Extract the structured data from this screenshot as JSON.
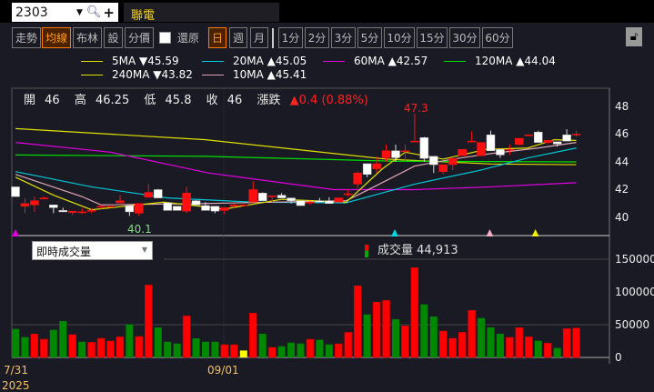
{
  "header": {
    "symbol": "2303",
    "stock_name": "聯電"
  },
  "toolbar": {
    "buttons": [
      {
        "label": "走勢",
        "active": false
      },
      {
        "label": "均線",
        "active": true
      },
      {
        "label": "布林",
        "active": false
      },
      {
        "label": "設",
        "active": false
      },
      {
        "label": "分價",
        "active": false
      }
    ],
    "restore_label": "還原",
    "periods": [
      {
        "label": "日",
        "active": true
      },
      {
        "label": "週",
        "active": false
      },
      {
        "label": "月",
        "active": false
      }
    ],
    "minutes": [
      "1分",
      "2分",
      "3分",
      "5分",
      "10分",
      "15分",
      "30分",
      "60分"
    ]
  },
  "legend": [
    {
      "name": "5MA",
      "dir": "▼",
      "value": "45.59",
      "color": "#e0e000"
    },
    {
      "name": "20MA",
      "dir": "▲",
      "value": "45.05",
      "color": "#00d0e0"
    },
    {
      "name": "60MA",
      "dir": "▲",
      "value": "42.57",
      "color": "#e000e0"
    },
    {
      "name": "120MA",
      "dir": "▲",
      "value": "44.04",
      "color": "#00e000"
    },
    {
      "name": "240MA",
      "dir": "▼",
      "value": "43.82",
      "color": "#e0e000"
    },
    {
      "name": "10MA",
      "dir": "▲",
      "value": "45.41",
      "color": "#e0a0b0"
    }
  ],
  "info": {
    "open_label": "開",
    "open": "46",
    "high_label": "高",
    "high": "46.25",
    "low_label": "低",
    "low": "45.8",
    "close_label": "收",
    "close": "46",
    "change_label": "漲跌",
    "change": "▲0.4 (0.88%)"
  },
  "volume_panel": {
    "selector": "即時成交量",
    "legend_label": "成交量",
    "legend_value": "44,913"
  },
  "dates": {
    "d1": "7/31",
    "d2": "09/01",
    "year": "2025"
  },
  "chart_data": {
    "type": "candlestick",
    "price_axis": {
      "ticks": [
        "48",
        "46",
        "44",
        "42",
        "40"
      ],
      "range": [
        39,
        49
      ]
    },
    "volume_axis": {
      "ticks": [
        "150000",
        "100000",
        "50000",
        "0"
      ],
      "range": [
        0,
        185000
      ]
    },
    "high_label": "47.3",
    "low_label": "40.1",
    "ohlc": [
      [
        42.2,
        42.2,
        41.5,
        41.5
      ],
      [
        40.8,
        41.4,
        40.3,
        41.0
      ],
      [
        40.9,
        41.5,
        40.4,
        41.2
      ],
      [
        41.35,
        41.5,
        41.3,
        41.4
      ],
      [
        40.9,
        40.9,
        40.3,
        40.7
      ],
      [
        40.5,
        40.7,
        40.4,
        40.4
      ],
      [
        40.35,
        40.45,
        40.15,
        40.45
      ],
      [
        40.4,
        40.65,
        40.25,
        40.4
      ],
      [
        40.45,
        40.65,
        40.3,
        40.5
      ],
      [
        40.8,
        40.9,
        40.6,
        40.8
      ],
      [
        40.8,
        40.9,
        40.7,
        40.8
      ],
      [
        41.05,
        41.6,
        40.9,
        41.2
      ],
      [
        40.85,
        40.85,
        40.1,
        40.4
      ],
      [
        40.3,
        41.0,
        40.1,
        41.0
      ],
      [
        41.45,
        42.4,
        41.45,
        41.8
      ],
      [
        42.0,
        42.05,
        41.4,
        41.4
      ],
      [
        41.05,
        41.05,
        40.5,
        40.5
      ],
      [
        40.8,
        40.8,
        40.5,
        40.5
      ],
      [
        40.45,
        42.2,
        40.3,
        41.75
      ],
      [
        41.2,
        41.25,
        40.9,
        40.9
      ],
      [
        40.85,
        41.1,
        40.5,
        40.5
      ],
      [
        40.8,
        40.8,
        40.3,
        40.45
      ],
      [
        40.5,
        40.7,
        40.25,
        40.7
      ],
      [
        40.8,
        41.0,
        40.7,
        40.9
      ],
      [
        40.9,
        40.95,
        40.85,
        40.9
      ],
      [
        41.1,
        42.6,
        41.1,
        42.0
      ],
      [
        41.75,
        41.8,
        41.2,
        41.2
      ],
      [
        41.5,
        41.55,
        41.1,
        41.55
      ],
      [
        41.6,
        41.75,
        41.4,
        41.4
      ],
      [
        41.4,
        41.4,
        41.0,
        41.2
      ],
      [
        41.2,
        41.2,
        40.85,
        40.85
      ],
      [
        41.1,
        41.2,
        40.9,
        41.1
      ],
      [
        41.2,
        41.4,
        41.1,
        41.1
      ],
      [
        41.2,
        41.45,
        41.0,
        41.0
      ],
      [
        41.1,
        41.4,
        41.1,
        41.4
      ],
      [
        41.7,
        42.0,
        41.5,
        41.7
      ],
      [
        42.4,
        43.3,
        42.1,
        43.2
      ],
      [
        43.87,
        43.87,
        42.9,
        43.1
      ],
      [
        43.5,
        44.4,
        43.2,
        43.87
      ],
      [
        44.3,
        45.25,
        44.0,
        44.8
      ],
      [
        44.8,
        45.25,
        44.0,
        44.3
      ],
      [
        44.75,
        45.25,
        44.05,
        44.8
      ],
      [
        45.45,
        47.3,
        45.4,
        45.5
      ],
      [
        45.75,
        45.8,
        44.0,
        44.25
      ],
      [
        44.4,
        44.4,
        43.2,
        43.8
      ],
      [
        43.3,
        43.8,
        43.1,
        43.8
      ],
      [
        43.8,
        44.25,
        43.4,
        44.25
      ],
      [
        44.45,
        44.9,
        44.45,
        44.9
      ],
      [
        45.45,
        46.2,
        45.4,
        45.5
      ],
      [
        44.45,
        45.4,
        44.45,
        45.4
      ],
      [
        45.95,
        46.25,
        44.8,
        44.8
      ],
      [
        44.9,
        44.9,
        44.3,
        44.5
      ],
      [
        44.85,
        45.25,
        44.5,
        44.9
      ],
      [
        45.25,
        45.7,
        45.2,
        45.7
      ],
      [
        45.9,
        46.0,
        45.9,
        45.95
      ],
      [
        46.15,
        46.25,
        45.4,
        45.4
      ],
      [
        45.4,
        45.55,
        45.3,
        45.55
      ],
      [
        45.45,
        45.45,
        45.1,
        45.3
      ],
      [
        45.95,
        46.35,
        45.5,
        45.5
      ],
      [
        46.0,
        46.25,
        45.8,
        46.0
      ]
    ],
    "volume": [
      43500,
      31000,
      35600,
      27800,
      42100,
      55500,
      34700,
      24000,
      23100,
      29200,
      25000,
      31500,
      50500,
      32000,
      110600,
      45800,
      24000,
      21300,
      63400,
      29200,
      24000,
      24000,
      19400,
      19400,
      10600,
      67600,
      36100,
      15300,
      17100,
      22700,
      21300,
      27800,
      26900,
      19900,
      20800,
      38400,
      109300,
      65700,
      84300,
      87000,
      58300,
      48100,
      137000,
      81000,
      62500,
      40300,
      29200,
      38400,
      71800,
      60200,
      45800,
      36100,
      30600,
      45400,
      31500,
      25500,
      21800,
      14400,
      44000,
      44913
    ],
    "volume_colors": [
      "g",
      "g",
      "r",
      "r",
      "g",
      "g",
      "r",
      "g",
      "r",
      "r",
      "r",
      "r",
      "g",
      "r",
      "r",
      "g",
      "g",
      "g",
      "r",
      "g",
      "g",
      "g",
      "r",
      "r",
      "y",
      "r",
      "g",
      "r",
      "g",
      "g",
      "g",
      "r",
      "g",
      "g",
      "r",
      "r",
      "r",
      "g",
      "r",
      "r",
      "g",
      "r",
      "r",
      "g",
      "g",
      "r",
      "r",
      "r",
      "r",
      "g",
      "g",
      "g",
      "r",
      "r",
      "r",
      "g",
      "r",
      "g",
      "r",
      "r"
    ],
    "ma_lines": [
      {
        "name": "240MA",
        "color": "#e0e000",
        "points": [
          [
            0,
            46.4
          ],
          [
            20,
            45.6
          ],
          [
            39,
            44.2
          ],
          [
            50,
            43.85
          ],
          [
            59,
            43.8
          ]
        ]
      },
      {
        "name": "120MA",
        "color": "#00e000",
        "points": [
          [
            0,
            44.5
          ],
          [
            20,
            44.4
          ],
          [
            40,
            44.05
          ],
          [
            59,
            44.0
          ]
        ]
      },
      {
        "name": "60MA",
        "color": "#e000e0",
        "points": [
          [
            0,
            45.4
          ],
          [
            10,
            44.7
          ],
          [
            20.3,
            43.2
          ],
          [
            33.5,
            42.0
          ],
          [
            42,
            42.0
          ],
          [
            50,
            42.2
          ],
          [
            59,
            42.5
          ]
        ]
      },
      {
        "name": "20MA",
        "color": "#00c8d8",
        "points": [
          [
            0,
            43.3
          ],
          [
            8,
            42.2
          ],
          [
            16,
            41.4
          ],
          [
            25,
            41.1
          ],
          [
            34.8,
            41.05
          ],
          [
            42,
            42.4
          ],
          [
            48.9,
            43.4
          ],
          [
            54,
            44.3
          ],
          [
            59,
            45.0
          ]
        ]
      },
      {
        "name": "10MA",
        "color": "#e0a8b4",
        "points": [
          [
            0,
            43.1
          ],
          [
            7,
            41.5
          ],
          [
            9,
            40.9
          ],
          [
            20,
            41.0
          ],
          [
            34.8,
            41.2
          ],
          [
            38,
            42.3
          ],
          [
            42,
            43.7
          ],
          [
            46,
            44.2
          ],
          [
            50,
            44.6
          ],
          [
            55,
            45.0
          ],
          [
            59,
            45.4
          ]
        ]
      },
      {
        "name": "5MA",
        "color": "#e0e000",
        "points": [
          [
            0,
            42.9
          ],
          [
            4,
            41.6
          ],
          [
            8,
            40.55
          ],
          [
            15.6,
            41.1
          ],
          [
            22,
            40.6
          ],
          [
            28,
            41.3
          ],
          [
            34.8,
            41.1
          ],
          [
            38.6,
            43.5
          ],
          [
            41,
            44.7
          ],
          [
            45,
            44.2
          ],
          [
            49.5,
            44.9
          ],
          [
            53.9,
            45.0
          ],
          [
            56.7,
            45.6
          ],
          [
            59,
            45.55
          ]
        ]
      }
    ],
    "signal_markers": [
      {
        "index": 0,
        "color": "#e000e0"
      },
      {
        "index": 39.9,
        "color": "#00d8e8"
      },
      {
        "index": 49.9,
        "color": "#f0b0c0"
      },
      {
        "index": 54.7,
        "color": "#f0f000"
      }
    ]
  }
}
